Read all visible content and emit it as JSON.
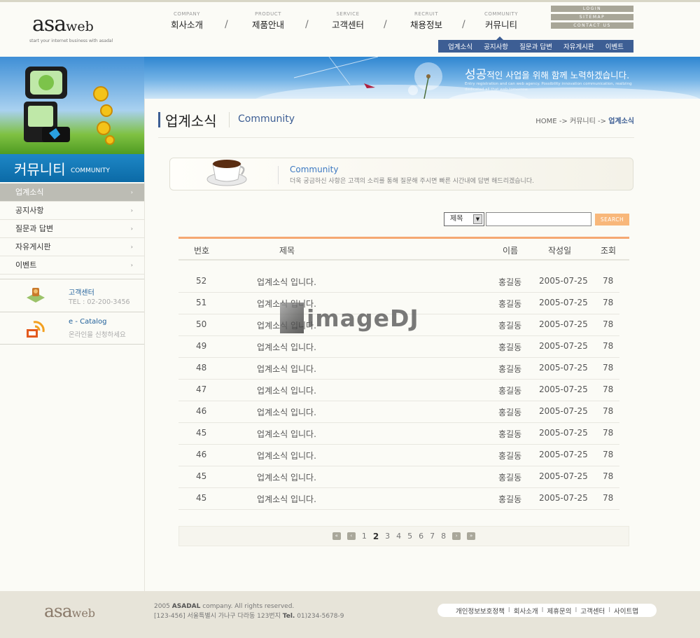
{
  "logo": {
    "main": "asa",
    "sub": "web",
    "tagline": "start your internet business with asadal"
  },
  "gnb": [
    {
      "en": "COMPANY",
      "ko": "회사소개"
    },
    {
      "en": "PRODUCT",
      "ko": "제품안내"
    },
    {
      "en": "SERVICE",
      "ko": "고객센터"
    },
    {
      "en": "RECRUIT",
      "ko": "채용정보"
    },
    {
      "en": "COMMUNITY",
      "ko": "커뮤니티"
    }
  ],
  "gnb_separator": "/",
  "util_links": [
    "LOGIN",
    "SITEMAP",
    "CONTACT US"
  ],
  "subnav": [
    "업계소식",
    "공지사항",
    "질문과 답변",
    "자유게시판",
    "이벤트"
  ],
  "banner": {
    "slogan_strong": "성공",
    "slogan_rest": "적인 사업을 위해 함께 노력하겠습니다.",
    "slogan_sub": "Entry registration and can web agency. Possibility innovation communication, realizing dedicated all that web tomorrow."
  },
  "section": {
    "title_ko": "커뮤니티",
    "title_en": "COMMUNITY"
  },
  "left_menu": [
    {
      "label": "업계소식",
      "active": true
    },
    {
      "label": "공지사항"
    },
    {
      "label": "질문과 답변"
    },
    {
      "label": "자유게시판"
    },
    {
      "label": "이벤트"
    }
  ],
  "menu_arrow": "›",
  "customer_center": {
    "title": "고객센터",
    "tel": "TEL : 02-200-3456"
  },
  "catalog": {
    "title": "e - Catalog",
    "desc": "온라인을 신청하세요"
  },
  "page_title": {
    "ko": "업계소식",
    "en": "Community"
  },
  "breadcrumb": {
    "home": "HOME",
    "arrow": "->",
    "parent": "커뮤니티",
    "current": "업계소식"
  },
  "intro": {
    "title": "Community",
    "desc": "더욱 궁금하신 사항은 고객의 소리를 통해 질문해 주시면 빠른 시간내에 답변 해드리겠습니다."
  },
  "search": {
    "select_value": "제목",
    "select_arrow": "▼",
    "input_value": "",
    "button": "SEARCH"
  },
  "table": {
    "headers": [
      "번호",
      "제목",
      "이름",
      "작성일",
      "조회"
    ],
    "rows": [
      {
        "no": "52",
        "title": "업계소식 입니다.",
        "name": "홍길동",
        "date": "2005-07-25",
        "views": "78"
      },
      {
        "no": "51",
        "title": "업계소식 입니다.",
        "name": "홍길동",
        "date": "2005-07-25",
        "views": "78"
      },
      {
        "no": "50",
        "title": "업계소식 입니다.",
        "name": "홍길동",
        "date": "2005-07-25",
        "views": "78"
      },
      {
        "no": "49",
        "title": "업계소식 입니다.",
        "name": "홍길동",
        "date": "2005-07-25",
        "views": "78"
      },
      {
        "no": "48",
        "title": "업계소식 입니다.",
        "name": "홍길동",
        "date": "2005-07-25",
        "views": "78"
      },
      {
        "no": "47",
        "title": "업계소식 입니다.",
        "name": "홍길동",
        "date": "2005-07-25",
        "views": "78"
      },
      {
        "no": "46",
        "title": "업계소식 입니다.",
        "name": "홍길동",
        "date": "2005-07-25",
        "views": "78"
      },
      {
        "no": "45",
        "title": "업계소식 입니다.",
        "name": "홍길동",
        "date": "2005-07-25",
        "views": "78"
      },
      {
        "no": "46",
        "title": "업계소식 입니다.",
        "name": "홍길동",
        "date": "2005-07-25",
        "views": "78"
      },
      {
        "no": "45",
        "title": "업계소식 입니다.",
        "name": "홍길동",
        "date": "2005-07-25",
        "views": "78"
      },
      {
        "no": "45",
        "title": "업계소식 입니다.",
        "name": "홍길동",
        "date": "2005-07-25",
        "views": "78"
      }
    ]
  },
  "pagination": {
    "first": "«",
    "prev": "‹",
    "pages": [
      "1",
      "2",
      "3",
      "4",
      "5",
      "6",
      "7",
      "8"
    ],
    "current": "2",
    "next": "›",
    "last": "»"
  },
  "footer": {
    "logo_main": "asa",
    "logo_sub": "web",
    "copy_year": "2005",
    "copy_company": "ASADAL",
    "copy_rest": "company. All rights reserved.",
    "address": "[123-456] 서울특별시 가나구 다라동 123번지",
    "tel_label": "Tel.",
    "tel": "01)234-5678-9",
    "links": [
      "개인정보보호정책",
      "회사소개",
      "제휴문의",
      "고객센터",
      "사이트맵"
    ],
    "link_sep": "I"
  },
  "watermark": "imageDJ",
  "colors": {
    "accent": "#3d5e94",
    "orange": "#f5a872",
    "section_blue": "#0b6aa6",
    "footer_bg": "#e7e4d9"
  }
}
